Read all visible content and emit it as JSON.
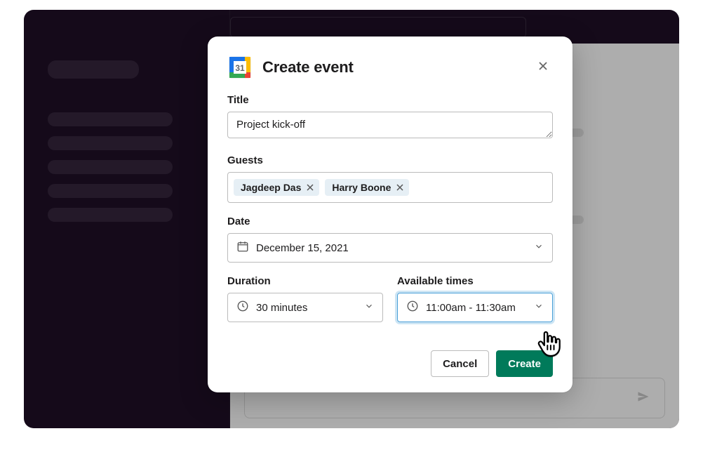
{
  "modal": {
    "title": "Create event",
    "icon_day": "31",
    "fields": {
      "title_label": "Title",
      "title_value": "Project kick-off",
      "guests_label": "Guests",
      "guests": [
        {
          "name": "Jagdeep Das"
        },
        {
          "name": "Harry Boone"
        }
      ],
      "date_label": "Date",
      "date_value": "December 15, 2021",
      "duration_label": "Duration",
      "duration_value": "30 minutes",
      "available_label": "Available times",
      "available_value": "11:00am - 11:30am"
    },
    "buttons": {
      "cancel": "Cancel",
      "create": "Create"
    }
  }
}
